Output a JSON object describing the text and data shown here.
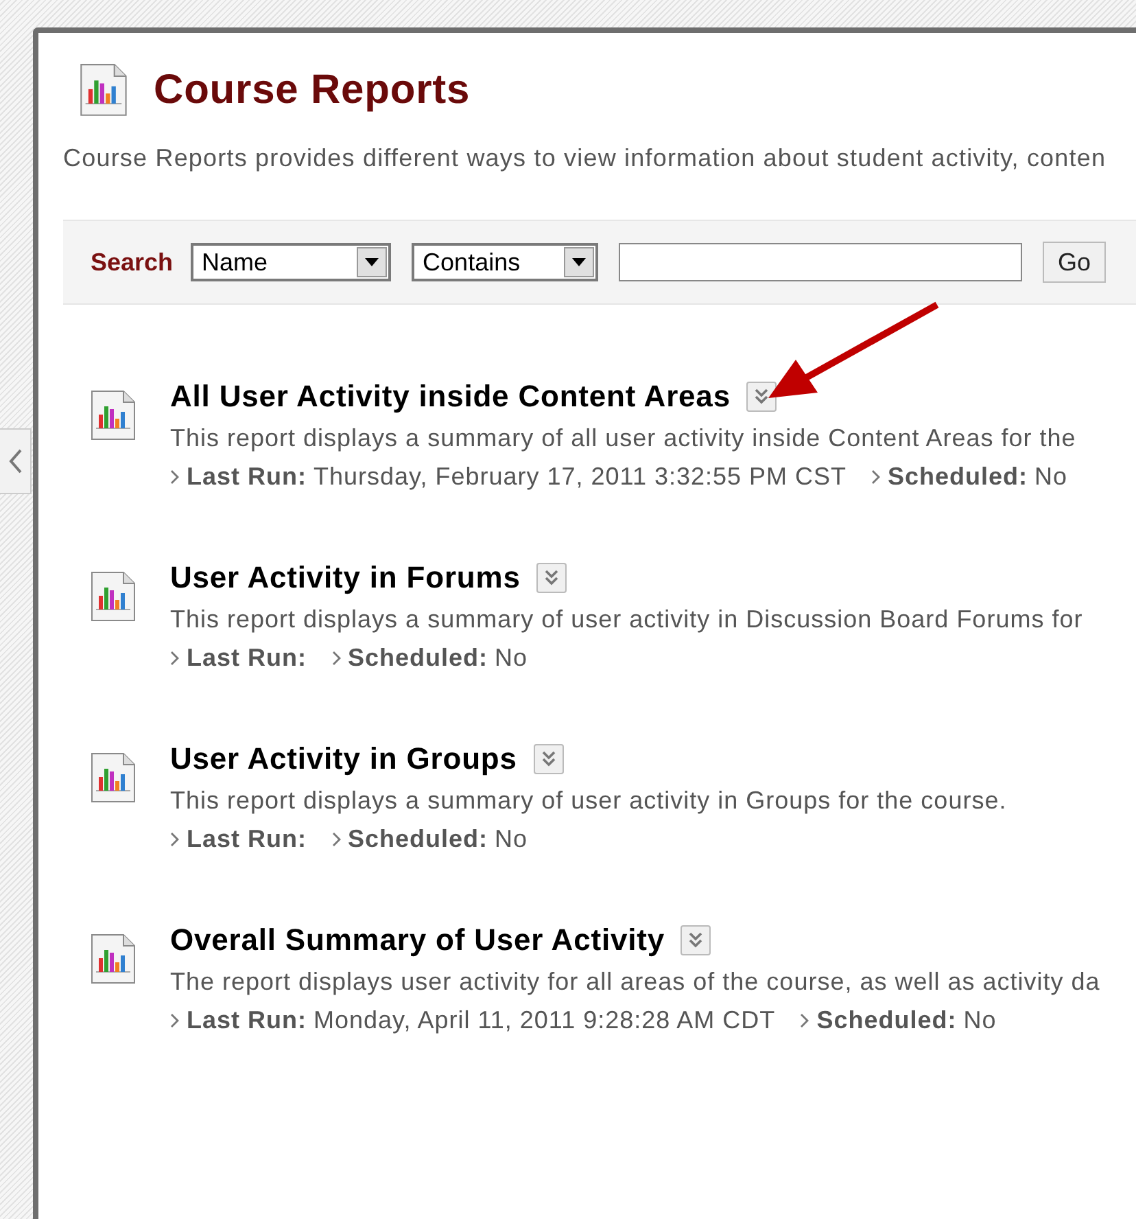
{
  "page": {
    "title": "Course Reports",
    "description": "Course Reports provides different ways to view information about student activity, conten"
  },
  "search": {
    "label": "Search",
    "field": "Name",
    "operator": "Contains",
    "button": "Go"
  },
  "reports": [
    {
      "title": "All User Activity inside Content Areas",
      "description": "This report displays a summary of all user activity inside Content Areas for the",
      "last_run_label": "Last Run:",
      "last_run": "Thursday, February 17, 2011 3:32:55 PM CST",
      "scheduled_label": "Scheduled:",
      "scheduled": "No",
      "annotated": true
    },
    {
      "title": "User Activity in Forums",
      "description": "This report displays a summary of user activity in Discussion Board Forums for",
      "last_run_label": "Last Run:",
      "scheduled_label": "Scheduled:",
      "scheduled": "No",
      "annotated": false
    },
    {
      "title": "User Activity in Groups",
      "description": "This report displays a summary of user activity in Groups for the course.",
      "last_run_label": "Last Run:",
      "scheduled_label": "Scheduled:",
      "scheduled": "No",
      "annotated": false
    },
    {
      "title": "Overall Summary of User Activity",
      "description": "The report displays user activity for all areas of the course, as well as activity da",
      "last_run_label": "Last Run:",
      "last_run": "Monday, April 11, 2011 9:28:28 AM CDT",
      "scheduled_label": "Scheduled:",
      "scheduled": "No",
      "annotated": false
    }
  ]
}
